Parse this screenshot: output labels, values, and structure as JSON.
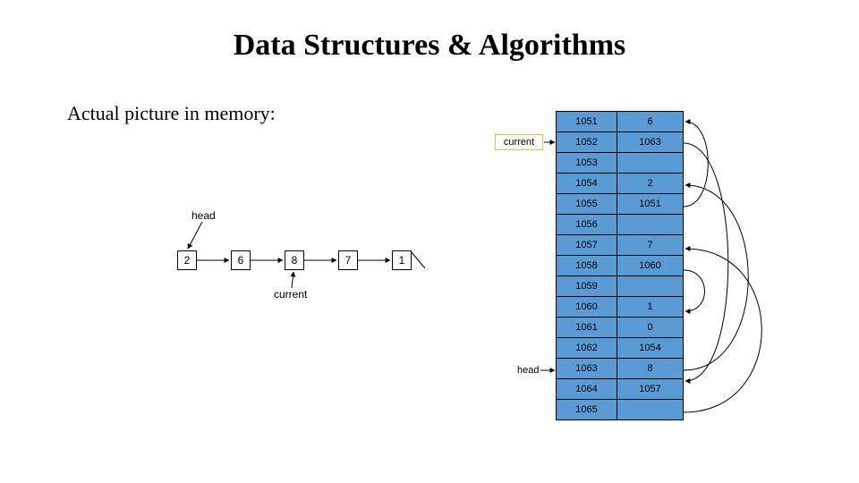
{
  "title": "Data Structures & Algorithms",
  "subtitle": "Actual picture in memory:",
  "labels": {
    "current_top": "current",
    "head_left": "head",
    "current_mid": "current",
    "head_right": "head"
  },
  "linked_list": [
    "2",
    "6",
    "8",
    "7",
    "1"
  ],
  "memory": [
    {
      "addr": "1051",
      "val": "6"
    },
    {
      "addr": "1052",
      "val": "1063"
    },
    {
      "addr": "1053",
      "val": ""
    },
    {
      "addr": "1054",
      "val": "2"
    },
    {
      "addr": "1055",
      "val": "1051"
    },
    {
      "addr": "1056",
      "val": ""
    },
    {
      "addr": "1057",
      "val": "7"
    },
    {
      "addr": "1058",
      "val": "1060"
    },
    {
      "addr": "1059",
      "val": ""
    },
    {
      "addr": "1060",
      "val": "1"
    },
    {
      "addr": "1061",
      "val": "0"
    },
    {
      "addr": "1062",
      "val": "1054"
    },
    {
      "addr": "1063",
      "val": "8"
    },
    {
      "addr": "1064",
      "val": "1057"
    },
    {
      "addr": "1065",
      "val": ""
    }
  ]
}
